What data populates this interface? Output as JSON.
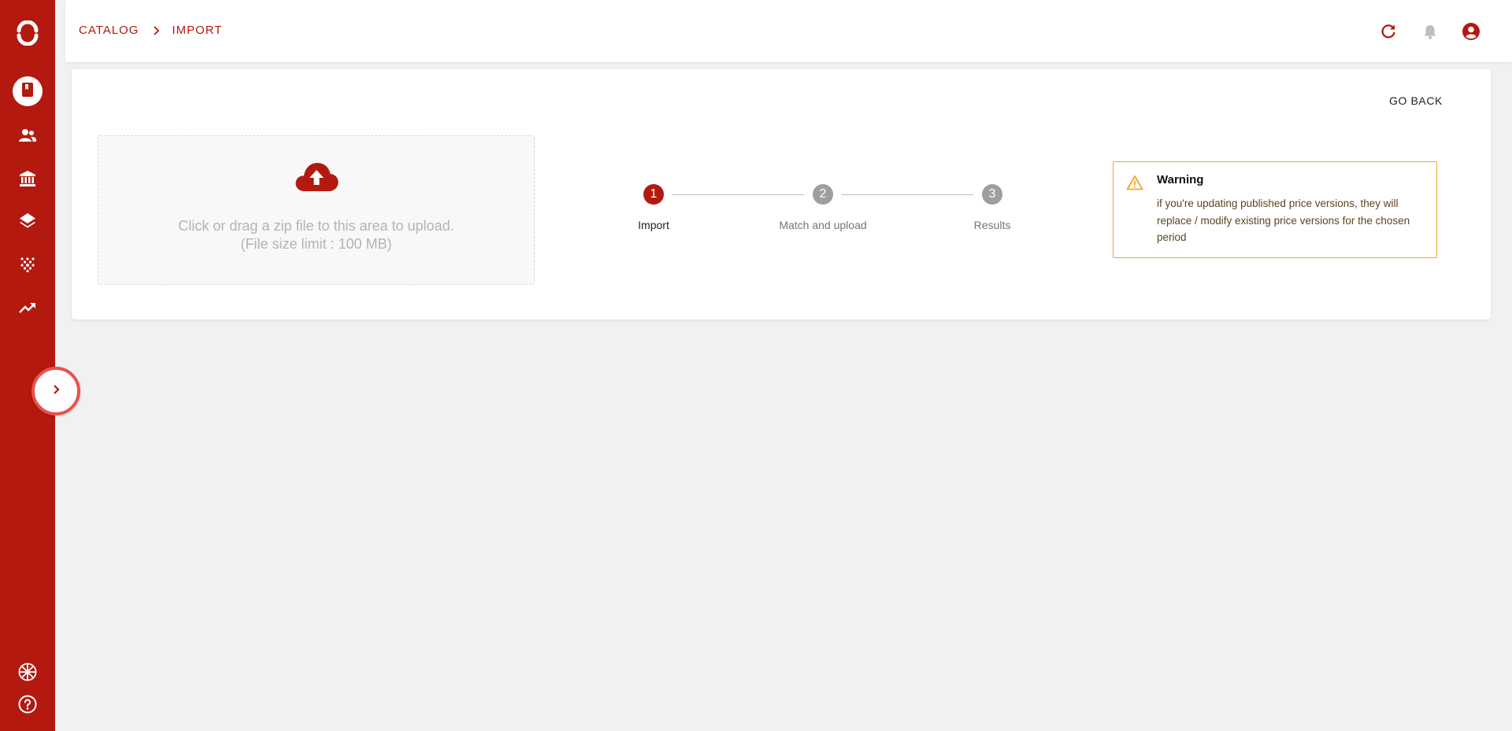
{
  "colors": {
    "brand": "#b3190f",
    "sidebar_bg": "#b3190f",
    "step_active": "#b3190f",
    "step_inactive": "#9e9e9e",
    "warning_border": "#f5a623",
    "page_bg": "#f1f1f1"
  },
  "sidebar": {
    "logo_icon": "sync-logo-icon",
    "items": [
      {
        "name": "catalog",
        "icon": "book-icon",
        "active": true
      },
      {
        "name": "users",
        "icon": "people-icon",
        "active": false
      },
      {
        "name": "institutions",
        "icon": "bank-icon",
        "active": false
      },
      {
        "name": "layers",
        "icon": "layers-icon",
        "active": false
      },
      {
        "name": "scatter",
        "icon": "dots-icon",
        "active": false
      },
      {
        "name": "analytics",
        "icon": "trending-up-icon",
        "active": false
      }
    ],
    "bottom": [
      {
        "name": "language",
        "icon": "uk-flag-icon"
      },
      {
        "name": "help",
        "icon": "help-icon"
      }
    ]
  },
  "header": {
    "breadcrumb": [
      "CATALOG",
      "IMPORT"
    ],
    "icons": [
      "refresh-icon",
      "bell-icon",
      "account-icon"
    ]
  },
  "card": {
    "go_back_label": "GO BACK",
    "upload": {
      "line1": "Click or drag a zip file to this area to upload.",
      "line2": "(File size limit : 100 MB)"
    },
    "stepper": {
      "current": 1,
      "steps": [
        {
          "number": "1",
          "label": "Import"
        },
        {
          "number": "2",
          "label": "Match and upload"
        },
        {
          "number": "3",
          "label": "Results"
        }
      ]
    },
    "warning": {
      "title": "Warning",
      "text": "if you're updating published price versions, they will replace / modify existing price versions for the chosen period"
    }
  }
}
